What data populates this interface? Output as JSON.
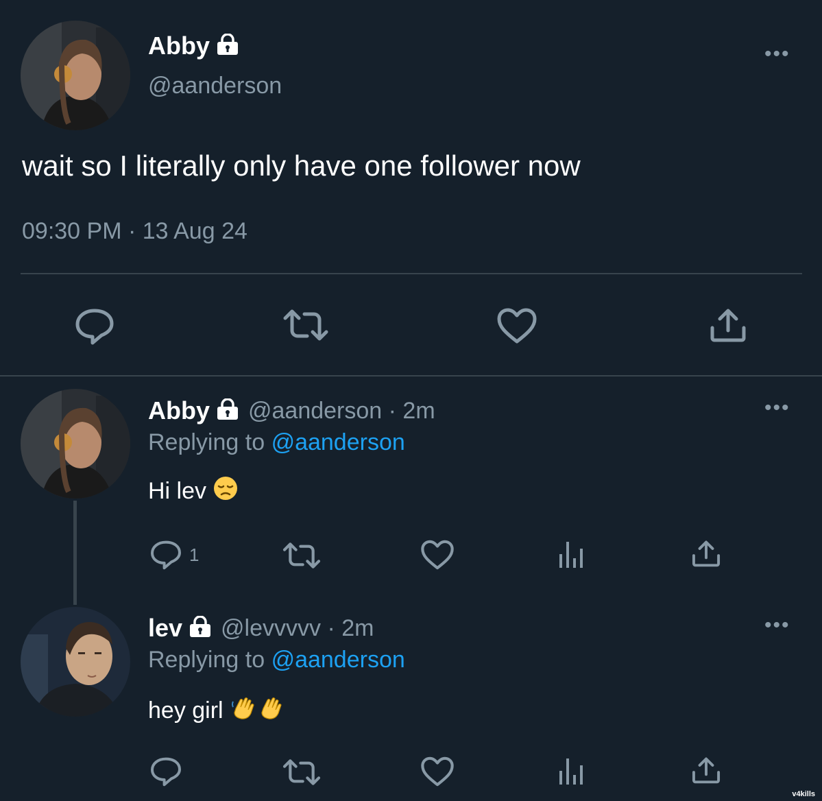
{
  "main_tweet": {
    "display_name": "Abby",
    "handle": "@aanderson",
    "text": "wait so I literally only have one follower now",
    "timestamp": "09:30 PM · 13 Aug 24",
    "actions": [
      "reply-icon",
      "retweet-icon",
      "like-icon",
      "share-icon"
    ]
  },
  "replies": [
    {
      "display_name": "Abby",
      "handle_time": "@aanderson · 2m",
      "replying_prefix": "Replying to",
      "replying_to": "@aanderson",
      "text": "Hi lev",
      "emoji": "pensive-face",
      "reply_count": "1"
    },
    {
      "display_name": "lev",
      "handle_time": "@levvvvv · 2m",
      "replying_prefix": "Replying to",
      "replying_to": "@aanderson",
      "text": "hey girl",
      "emoji": "waving-hands"
    }
  ],
  "watermark": "v4kills",
  "colors": {
    "background": "#15202b",
    "muted": "#8899a6",
    "link": "#1da1f2",
    "divider": "#38444d"
  }
}
